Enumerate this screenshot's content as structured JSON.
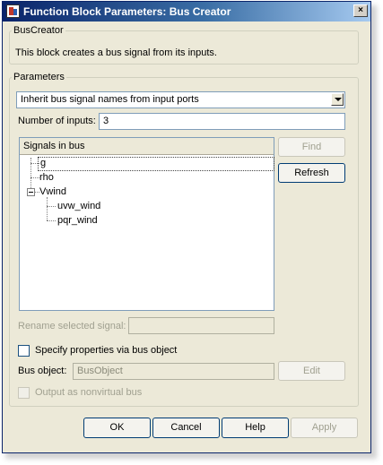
{
  "window": {
    "title": "Function Block Parameters: Bus Creator",
    "close_symbol": "×"
  },
  "description": {
    "group_title": "BusCreator",
    "text": "This block creates a bus signal from its inputs."
  },
  "parameters": {
    "group_title": "Parameters",
    "naming_mode": {
      "selected": "Inherit bus signal names from input ports"
    },
    "num_inputs": {
      "label": "Number of inputs:",
      "value": "3"
    },
    "signals_header": "Signals in bus",
    "signals": {
      "g": "g",
      "rho": "rho",
      "vwind": "Vwind",
      "uvw_wind": "uvw_wind",
      "pqr_wind": "pqr_wind"
    },
    "find_label": "Find",
    "refresh_label": "Refresh",
    "rename_label": "Rename selected signal:",
    "rename_value": "",
    "specify_bus_object_label": "Specify properties via bus object",
    "bus_object_label": "Bus object:",
    "bus_object_value": "BusObject",
    "edit_label": "Edit",
    "output_nonvirtual_label": "Output as nonvirtual bus"
  },
  "footer": {
    "ok": "OK",
    "cancel": "Cancel",
    "help": "Help",
    "apply": "Apply"
  },
  "colors": {
    "titlebar_start": "#0a246a",
    "titlebar_end": "#a6caf0",
    "dialog_bg": "#ece9d8",
    "field_border": "#7f9db9"
  }
}
